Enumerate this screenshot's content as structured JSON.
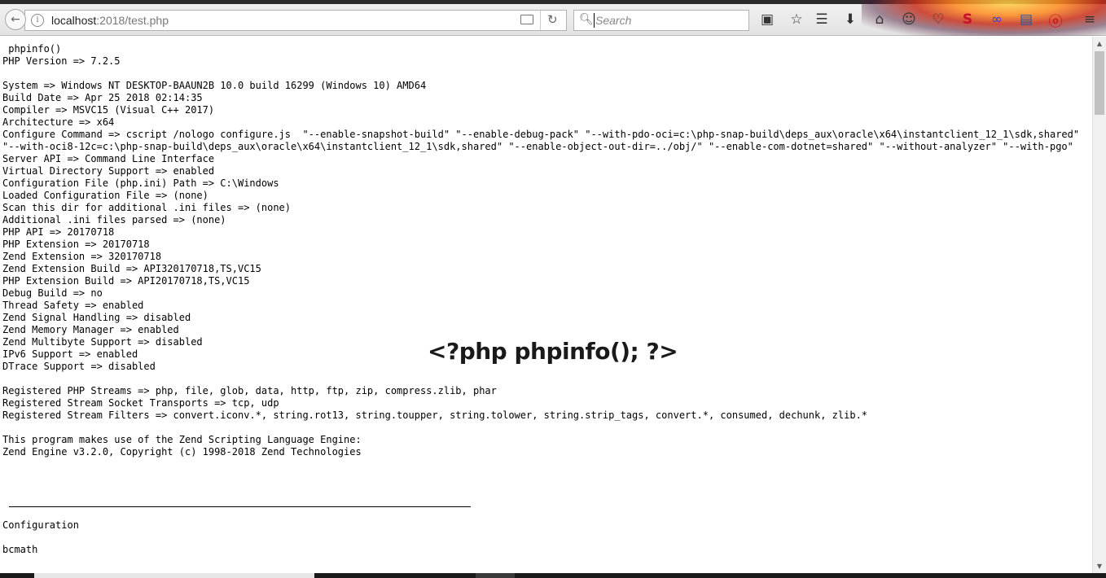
{
  "browser": {
    "url_host": "localhost",
    "url_path": ":2018/test.php",
    "search_placeholder": "Search",
    "info_glyph": "i"
  },
  "toolbar_icons": [
    "screenshot-icon",
    "star-icon",
    "reading-list-icon",
    "download-icon",
    "home-icon",
    "emoji-icon",
    "pocket-icon",
    "extension-s-icon",
    "extension-link-icon",
    "extension-box-icon",
    "extension-o-icon",
    "menu-icon"
  ],
  "page": {
    "output_lines": [
      " phpinfo()",
      "PHP Version => 7.2.5",
      "",
      "System => Windows NT DESKTOP-BAAUN2B 10.0 build 16299 (Windows 10) AMD64",
      "Build Date => Apr 25 2018 02:14:35",
      "Compiler => MSVC15 (Visual C++ 2017)",
      "Architecture => x64",
      "Configure Command => cscript /nologo configure.js  \"--enable-snapshot-build\" \"--enable-debug-pack\" \"--with-pdo-oci=c:\\php-snap-build\\deps_aux\\oracle\\x64\\instantclient_12_1\\sdk,shared\" \"--with-oci8-12c=c:\\php-snap-build\\deps_aux\\oracle\\x64\\instantclient_12_1\\sdk,shared\" \"--enable-object-out-dir=../obj/\" \"--enable-com-dotnet=shared\" \"--without-analyzer\" \"--with-pgo\"",
      "Server API => Command Line Interface",
      "Virtual Directory Support => enabled",
      "Configuration File (php.ini) Path => C:\\Windows",
      "Loaded Configuration File => (none)",
      "Scan this dir for additional .ini files => (none)",
      "Additional .ini files parsed => (none)",
      "PHP API => 20170718",
      "PHP Extension => 20170718",
      "Zend Extension => 320170718",
      "Zend Extension Build => API320170718,TS,VC15",
      "PHP Extension Build => API20170718,TS,VC15",
      "Debug Build => no",
      "Thread Safety => enabled",
      "Zend Signal Handling => disabled",
      "Zend Memory Manager => enabled",
      "Zend Multibyte Support => disabled",
      "IPv6 Support => enabled",
      "DTrace Support => disabled",
      "",
      "Registered PHP Streams => php, file, glob, data, http, ftp, zip, compress.zlib, phar",
      "Registered Stream Socket Transports => tcp, udp",
      "Registered Stream Filters => convert.iconv.*, string.rot13, string.toupper, string.tolower, string.strip_tags, convert.*, consumed, dechunk, zlib.*",
      "",
      "This program makes use of the Zend Scripting Language Engine:",
      "Zend Engine v3.2.0, Copyright (c) 1998-2018 Zend Technologies",
      "",
      "",
      "",
      "",
      "",
      "Configuration",
      "",
      "bcmath"
    ],
    "overlay_text": "<?php phpinfo(); ?>"
  }
}
